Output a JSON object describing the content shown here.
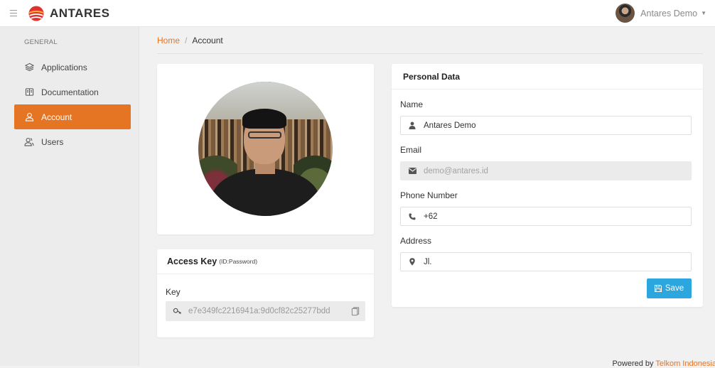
{
  "app": {
    "brand": "ANTARES",
    "user_name": "Antares Demo"
  },
  "sidebar": {
    "section_label": "GENERAL",
    "items": [
      {
        "label": "Applications",
        "icon": "layers-icon",
        "active": false
      },
      {
        "label": "Documentation",
        "icon": "book-icon",
        "active": false
      },
      {
        "label": "Account",
        "icon": "user-icon",
        "active": true
      },
      {
        "label": "Users",
        "icon": "users-icon",
        "active": false
      }
    ]
  },
  "breadcrumb": {
    "home": "Home",
    "separator": "/",
    "current": "Account"
  },
  "access_key": {
    "title": "Access Key",
    "subtitle": "(ID:Password)",
    "label": "Key",
    "value": "e7e349fc2216941a:9d0cf82c25277bdd"
  },
  "personal": {
    "title": "Personal Data",
    "name_label": "Name",
    "name_value": "Antares Demo",
    "email_label": "Email",
    "email_value": "demo@antares.id",
    "phone_label": "Phone Number",
    "phone_value": "+62",
    "address_label": "Address",
    "address_value": "Jl.",
    "save_label": "Save"
  },
  "footer": {
    "prefix": "Powered by",
    "brand": "Telkom Indonesia"
  },
  "colors": {
    "accent": "#e57423",
    "save_button": "#2ba6de",
    "sidebar_bg": "#ececec",
    "page_bg": "#f1f1f1"
  }
}
